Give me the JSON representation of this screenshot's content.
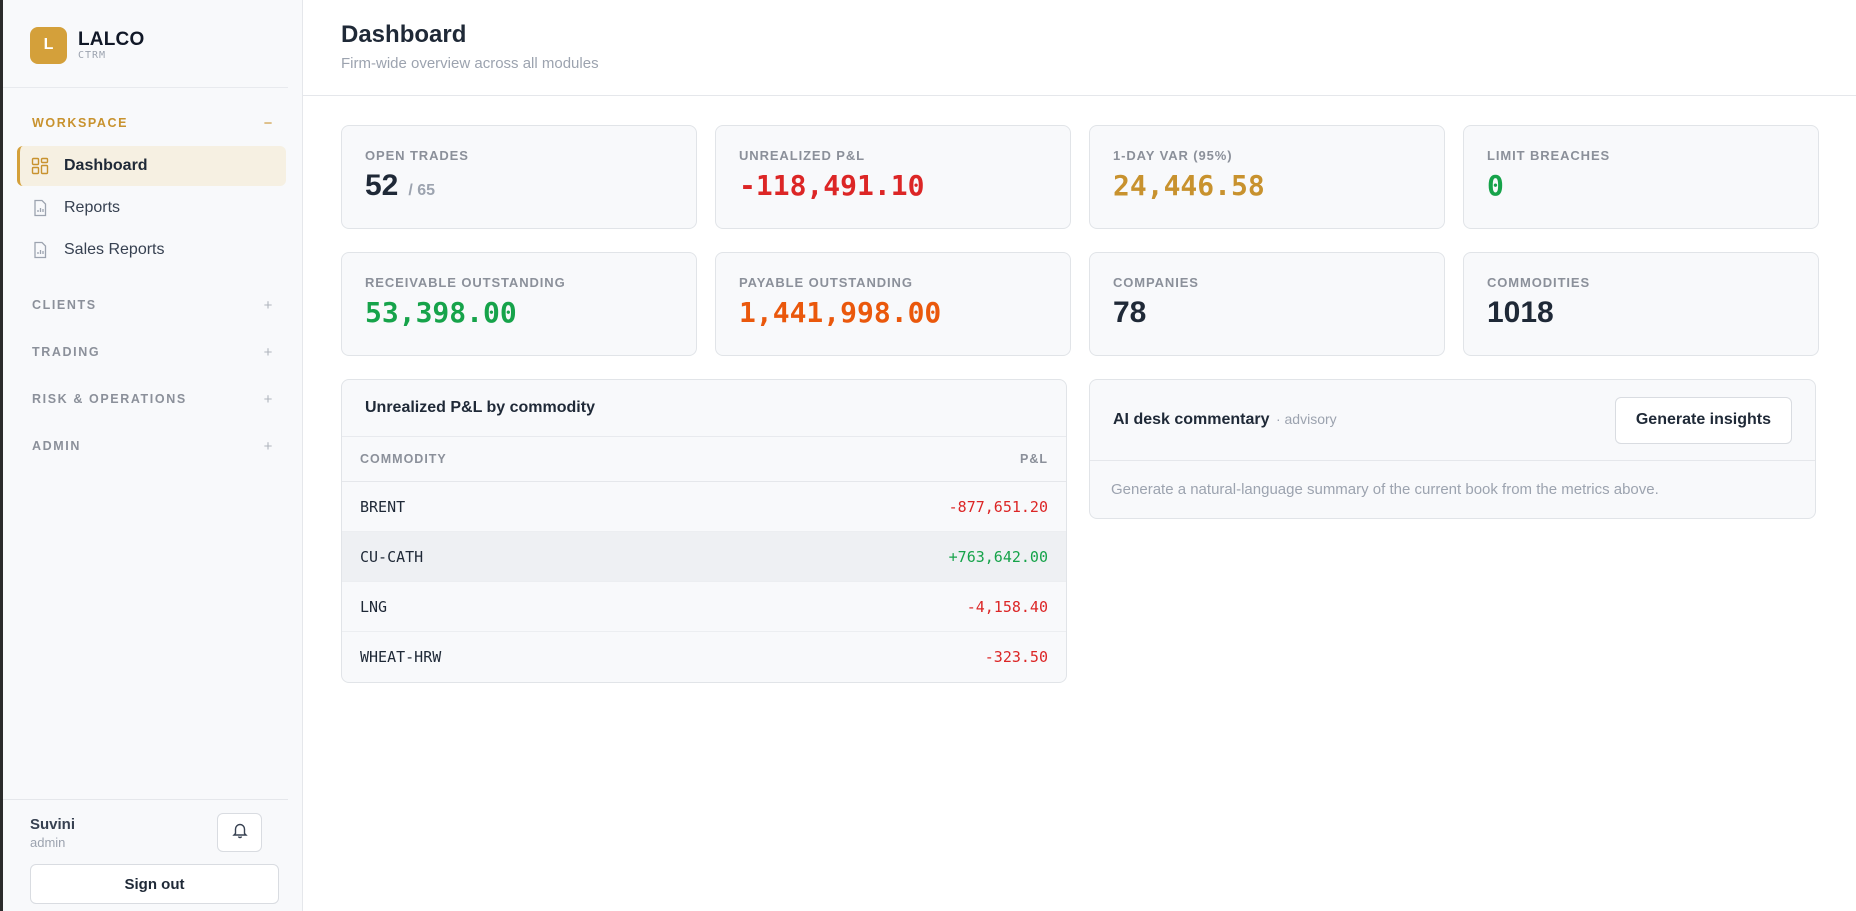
{
  "brand": {
    "logo_letter": "L",
    "name": "LALCO",
    "sub": "CTRM"
  },
  "nav": {
    "groups": [
      {
        "label": "WORKSPACE",
        "toggle": "−",
        "items": [
          {
            "label": "Dashboard",
            "icon": "dashboard-icon"
          },
          {
            "label": "Reports",
            "icon": "report-icon"
          },
          {
            "label": "Sales Reports",
            "icon": "report-icon"
          }
        ]
      },
      {
        "label": "CLIENTS",
        "toggle": "+"
      },
      {
        "label": "TRADING",
        "toggle": "+"
      },
      {
        "label": "RISK & OPERATIONS",
        "toggle": "+"
      },
      {
        "label": "ADMIN",
        "toggle": "+"
      }
    ]
  },
  "user": {
    "name": "Suvini",
    "role": "admin",
    "sign_out": "Sign out"
  },
  "header": {
    "title": "Dashboard",
    "subtitle": "Firm-wide overview across all modules"
  },
  "kpis": [
    {
      "label": "OPEN TRADES",
      "value": "52",
      "total": "/ 65",
      "color": "#1f2937"
    },
    {
      "label": "UNREALIZED P&L",
      "value": "-118,491.10",
      "color": "#dc2626"
    },
    {
      "label": "1-DAY VAR (95%)",
      "value": "24,446.58",
      "color": "#c8922e"
    },
    {
      "label": "LIMIT BREACHES",
      "value": "0",
      "color": "#16a34a"
    },
    {
      "label": "RECEIVABLE OUTSTANDING",
      "value": "53,398.00",
      "color": "#16a34a"
    },
    {
      "label": "PAYABLE OUTSTANDING",
      "value": "1,441,998.00",
      "color": "#ea580c"
    },
    {
      "label": "COMPANIES",
      "value": "78",
      "color": "#1f2937"
    },
    {
      "label": "COMMODITIES",
      "value": "1018",
      "color": "#1f2937"
    }
  ],
  "pnl": {
    "title": "Unrealized P&L by commodity",
    "columns": [
      "COMMODITY",
      "P&L"
    ],
    "rows": [
      {
        "commodity": "BRENT",
        "pnl": "-877,651.20"
      },
      {
        "commodity": "CU-CATH",
        "pnl": "+763,642.00"
      },
      {
        "commodity": "LNG",
        "pnl": "-4,158.40"
      },
      {
        "commodity": "WHEAT-HRW",
        "pnl": "-323.50"
      }
    ]
  },
  "ai": {
    "title": "AI desk commentary",
    "tag": "· advisory",
    "button": "Generate insights",
    "body": "Generate a natural-language summary of the current book from the metrics above."
  }
}
